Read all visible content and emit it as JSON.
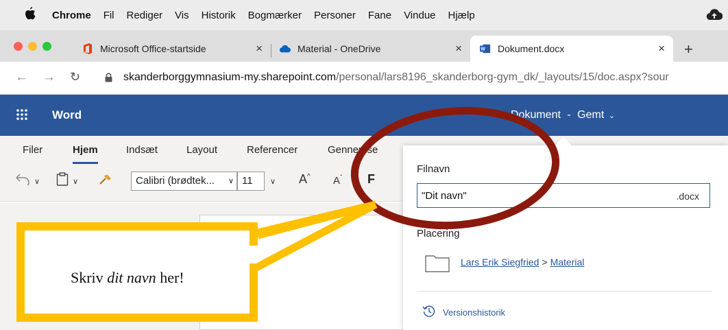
{
  "menubar": {
    "app": "Chrome",
    "items": [
      "Fil",
      "Rediger",
      "Vis",
      "Historik",
      "Bogmærker",
      "Personer",
      "Fane",
      "Vindue",
      "Hjælp"
    ]
  },
  "tabs": [
    {
      "title": "Microsoft Office-startside",
      "close": "×"
    },
    {
      "title": "Material - OneDrive",
      "close": "×"
    },
    {
      "title": "Dokument.docx",
      "close": "×"
    }
  ],
  "new_tab": "+",
  "address": {
    "host": "skanderborggymnasium-my.sharepoint.com",
    "path": "/personal/lars8196_skanderborg-gym_dk/_layouts/15/doc.aspx?sour"
  },
  "word": {
    "app_name": "Word",
    "doc_title": "Dokument",
    "separator": "-",
    "status": "Gemt"
  },
  "ribbon": {
    "tabs": [
      "Filer",
      "Hjem",
      "Indsæt",
      "Layout",
      "Referencer",
      "Gennemse"
    ],
    "font": "Calibri (brødtek...",
    "size": "11",
    "grow": "A",
    "shrink": "A",
    "bold": "F"
  },
  "flyout": {
    "filename_label": "Filnavn",
    "filename_value": "\"Dit navn\"",
    "extension": ".docx",
    "location_label": "Placering",
    "location_parent": "Lars Erik Siegfried",
    "location_sep": ">",
    "location_folder": "Material",
    "history": "Versionshistorik"
  },
  "annotation": {
    "pre": "Skriv ",
    "emph": "dit navn",
    "post": " her!",
    "callout_color": "#ffc000",
    "ring_color": "#8b1a0e"
  },
  "colors": {
    "word_blue": "#2b579a"
  }
}
